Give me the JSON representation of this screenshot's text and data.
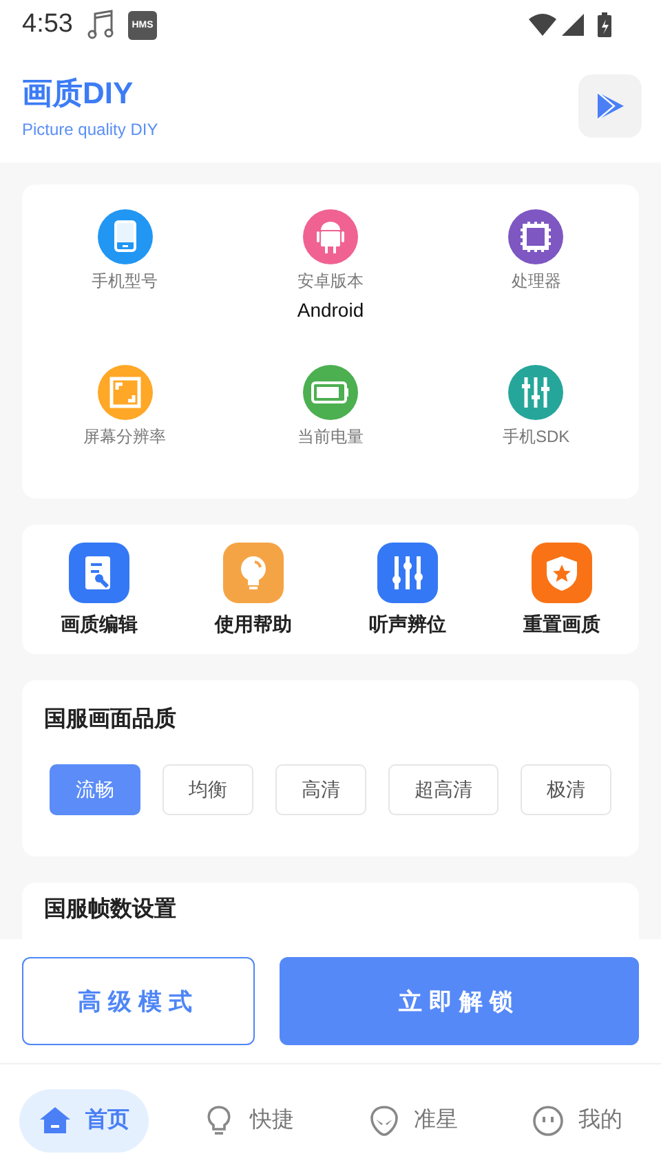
{
  "status_bar": {
    "time": "4:53",
    "badge": "HMS"
  },
  "header": {
    "title": "画质DIY",
    "subtitle": "Picture quality DIY"
  },
  "device_info": [
    {
      "label": "手机型号",
      "color": "#2196f3"
    },
    {
      "label": "安卓版本",
      "value": "Android",
      "color": "#f06292"
    },
    {
      "label": "处理器",
      "color": "#7e57c2"
    },
    {
      "label": "屏幕分辨率",
      "color": "#ffa726"
    },
    {
      "label": "当前电量",
      "color": "#4caf50"
    },
    {
      "label": "手机SDK",
      "color": "#26a69a"
    }
  ],
  "tools": [
    {
      "label": "画质编辑",
      "color": "#3478f6"
    },
    {
      "label": "使用帮助",
      "color": "#f5a445"
    },
    {
      "label": "听声辨位",
      "color": "#3478f6"
    },
    {
      "label": "重置画质",
      "color": "#f97316"
    }
  ],
  "quality": {
    "title": "国服画面品质",
    "options": [
      {
        "label": "流畅",
        "selected": true
      },
      {
        "label": "均衡",
        "selected": false
      },
      {
        "label": "高清",
        "selected": false
      },
      {
        "label": "超高清",
        "selected": false
      },
      {
        "label": "极清",
        "selected": false
      }
    ]
  },
  "next_section": {
    "title": "国服帧数设置"
  },
  "actions": {
    "secondary": "高级模式",
    "primary": "立即解锁"
  },
  "nav": [
    {
      "label": "首页",
      "selected": true
    },
    {
      "label": "快捷",
      "selected": false
    },
    {
      "label": "准星",
      "selected": false
    },
    {
      "label": "我的",
      "selected": false
    }
  ]
}
